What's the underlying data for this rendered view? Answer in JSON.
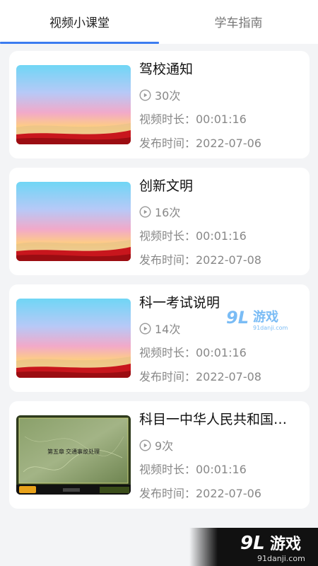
{
  "tabs": [
    {
      "label": "视频小课堂",
      "active": true
    },
    {
      "label": "学车指南",
      "active": false
    }
  ],
  "colors": {
    "accent": "#3c7cf0",
    "meta_text": "#888888",
    "title_text": "#111111"
  },
  "videos": [
    {
      "title": "驾校通知",
      "views": "30次",
      "duration": "视频时长：00:01:16",
      "date": "发布时间：2022-07-06",
      "thumbnail": "gradient-sky"
    },
    {
      "title": "创新文明",
      "views": "16次",
      "duration": "视频时长：00:01:16",
      "date": "发布时间：2022-07-08",
      "thumbnail": "gradient-sky"
    },
    {
      "title": "科一考试说明",
      "views": "14次",
      "duration": "视频时长：00:01:16",
      "date": "发布时间：2022-07-08",
      "thumbnail": "gradient-sky"
    },
    {
      "title": "科目一中华人民共和国…",
      "views": "9次",
      "duration": "视频时长：00:01:16",
      "date": "发布时间：2022-07-06",
      "thumbnail": "lesson-slide",
      "slide_text": "第五章 交通事故处理"
    }
  ],
  "watermark": {
    "brand": "游戏",
    "logo": "9L",
    "url": "91danji.com"
  }
}
